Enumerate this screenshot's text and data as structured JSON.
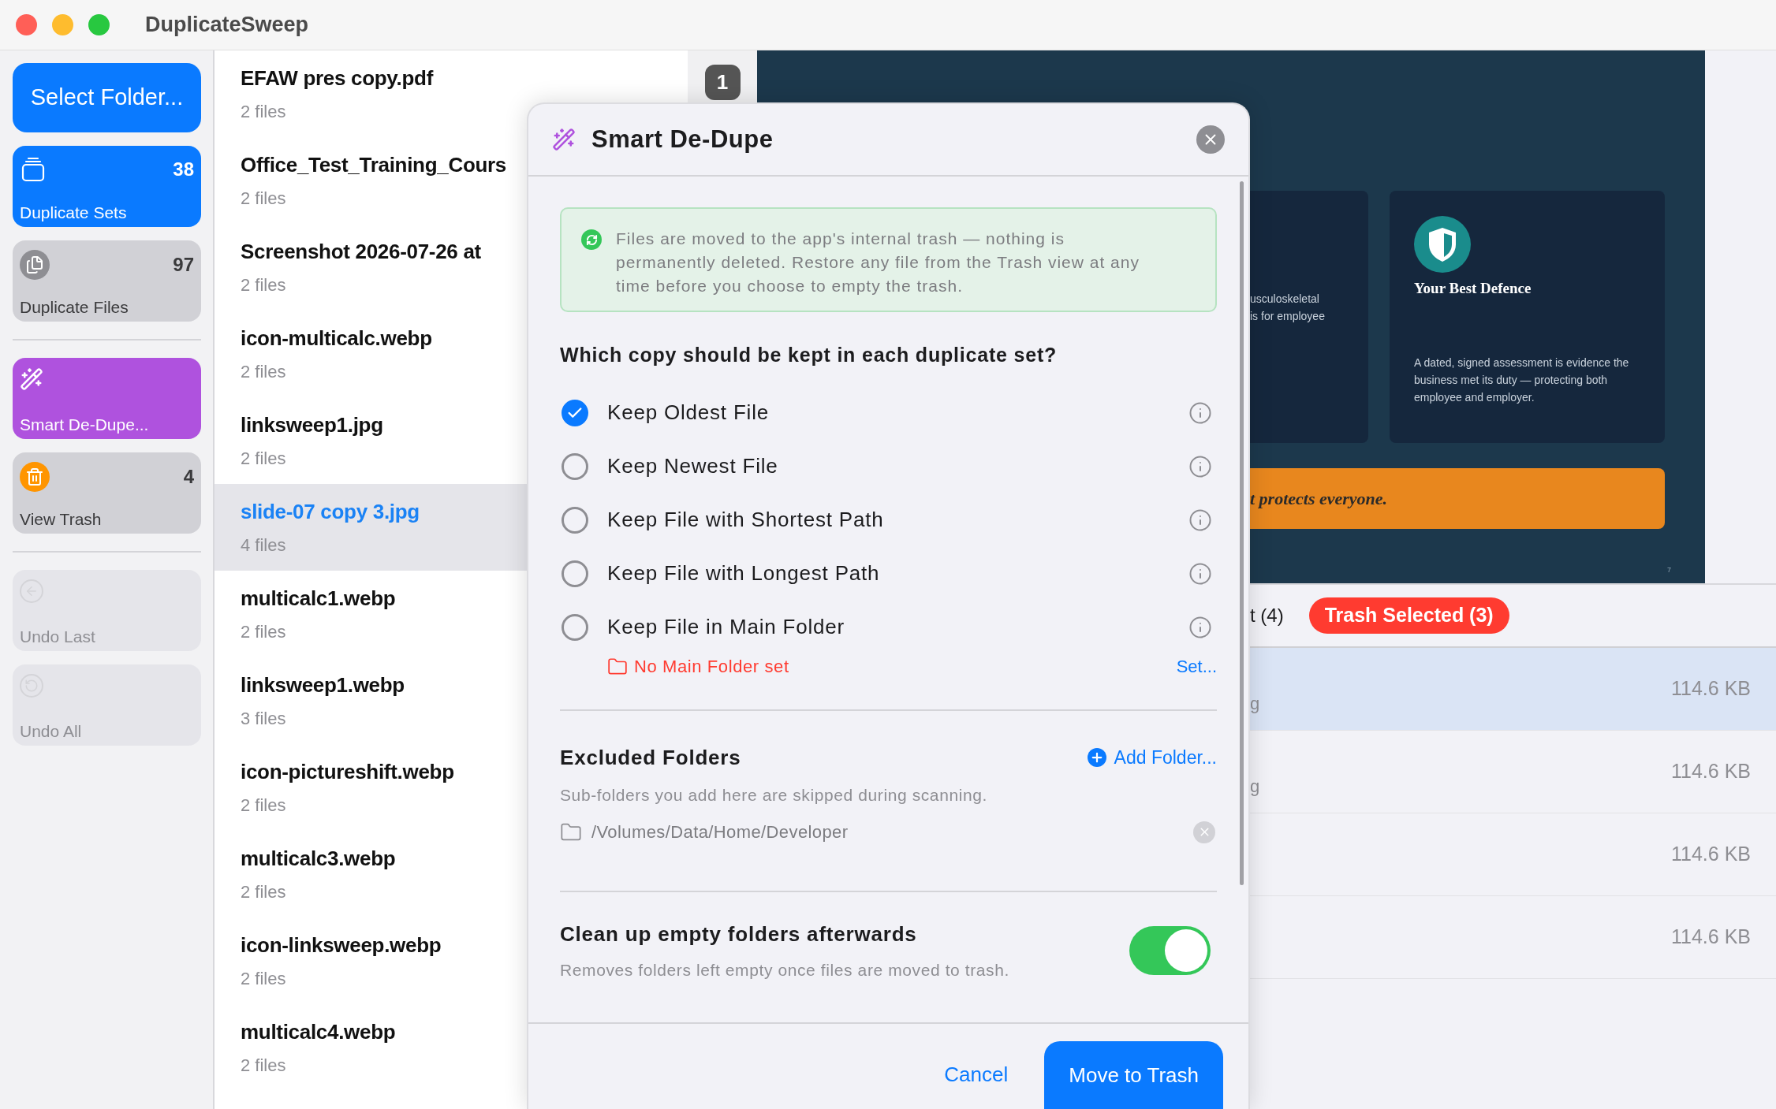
{
  "window": {
    "title": "DuplicateSweep"
  },
  "sidebar": {
    "select_button": "Select Folder...",
    "groups": [
      [
        {
          "kind": "sets",
          "label": "Duplicate Sets",
          "count": "38",
          "selected": true,
          "disabled": false
        },
        {
          "kind": "files",
          "label": "Duplicate Files",
          "count": "97",
          "selected": false,
          "disabled": false
        }
      ],
      [
        {
          "kind": "smart",
          "label": "Smart De-Dupe...",
          "disabled": false
        },
        {
          "kind": "trash",
          "label": "View Trash",
          "count": "4",
          "selected": false,
          "disabled": false
        }
      ],
      [
        {
          "kind": "undo_last",
          "label": "Undo Last",
          "disabled": true
        },
        {
          "kind": "undo_all",
          "label": "Undo All",
          "disabled": true
        }
      ]
    ]
  },
  "file_list": [
    {
      "name": "EFAW pres copy.pdf",
      "count": "2 files",
      "selected": false
    },
    {
      "name": "Office_Test_Training_Cours",
      "count": "2 files",
      "selected": false
    },
    {
      "name": "Screenshot 2026-07-26 at",
      "count": "2 files",
      "selected": false
    },
    {
      "name": "icon-multicalc.webp",
      "count": "2 files",
      "selected": false
    },
    {
      "name": "linksweep1.jpg",
      "count": "2 files",
      "selected": false
    },
    {
      "name": "slide-07 copy 3.jpg",
      "count": "4 files",
      "selected": true
    },
    {
      "name": "multicalc1.webp",
      "count": "2 files",
      "selected": false
    },
    {
      "name": "linksweep1.webp",
      "count": "3 files",
      "selected": false
    },
    {
      "name": "icon-pictureshift.webp",
      "count": "2 files",
      "selected": false
    },
    {
      "name": "multicalc3.webp",
      "count": "2 files",
      "selected": false
    },
    {
      "name": "icon-linksweep.webp",
      "count": "2 files",
      "selected": false
    },
    {
      "name": "multicalc4.webp",
      "count": "2 files",
      "selected": false
    }
  ],
  "preview": {
    "badge": "1",
    "slide": {
      "left_card_lines": [
        "usculoskeletal",
        "is for employee"
      ],
      "right_card": {
        "title": "Your Best Defence",
        "body": "A dated, signed assessment is evidence the business met its duty — protecting both employee and employer."
      },
      "banner": "t protects everyone.",
      "page_number": "7"
    }
  },
  "detail": {
    "toolbar_text": "t (4)",
    "trash_button": "Trash Selected (3)",
    "rows": [
      {
        "name": "g",
        "size": "114.6 KB",
        "selected": true
      },
      {
        "name": "g",
        "size": "114.6 KB",
        "selected": false
      },
      {
        "size": "114.6 KB",
        "selected": false
      },
      {
        "size": "114.6 KB",
        "selected": false
      }
    ]
  },
  "dialog": {
    "title": "Smart De-Dupe",
    "notice": "Files are moved to the app's internal trash — nothing is permanently deleted. Restore any file from the Trash view at any time before you choose to empty the trash.",
    "question": "Which copy should be kept in each duplicate set?",
    "options": [
      {
        "label": "Keep Oldest File",
        "selected": true
      },
      {
        "label": "Keep Newest File",
        "selected": false
      },
      {
        "label": "Keep File with Shortest Path",
        "selected": false
      },
      {
        "label": "Keep File with Longest Path",
        "selected": false
      },
      {
        "label": "Keep File in Main Folder",
        "selected": false
      }
    ],
    "main_folder_warning": "No Main Folder set",
    "set_link": "Set...",
    "excluded": {
      "title": "Excluded Folders",
      "add_button": "Add Folder...",
      "hint": "Sub-folders you add here are skipped during scanning.",
      "folders": [
        "/Volumes/Data/Home/Developer"
      ]
    },
    "cleanup": {
      "title": "Clean up empty folders afterwards",
      "hint": "Removes folders left empty once files are moved to trash.",
      "on": true
    },
    "cancel_button": "Cancel",
    "confirm_button": "Move to Trash"
  }
}
